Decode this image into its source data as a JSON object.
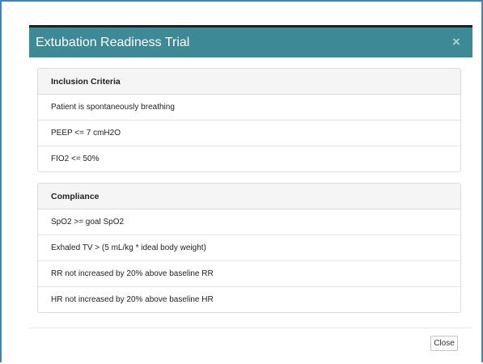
{
  "modal": {
    "title": "Extubation Readiness Trial",
    "close_icon": "×",
    "close_button_label": "Close"
  },
  "inclusion": {
    "heading": "Inclusion Criteria",
    "items": [
      "Patient is spontaneously breathing",
      "PEEP <= 7 cmH2O",
      "FIO2 <= 50%"
    ]
  },
  "compliance": {
    "heading": "Compliance",
    "items": [
      "SpO2 >= goal SpO2",
      "Exhaled TV > (5 mL/kg * ideal body weight)",
      "RR not increased by 20% above baseline RR",
      "HR not increased by 20% above baseline HR"
    ]
  },
  "colors": {
    "header_bg": "#3d8a96",
    "frame_border": "#3a86c3",
    "panel_heading_bg": "#f5f5f5"
  }
}
